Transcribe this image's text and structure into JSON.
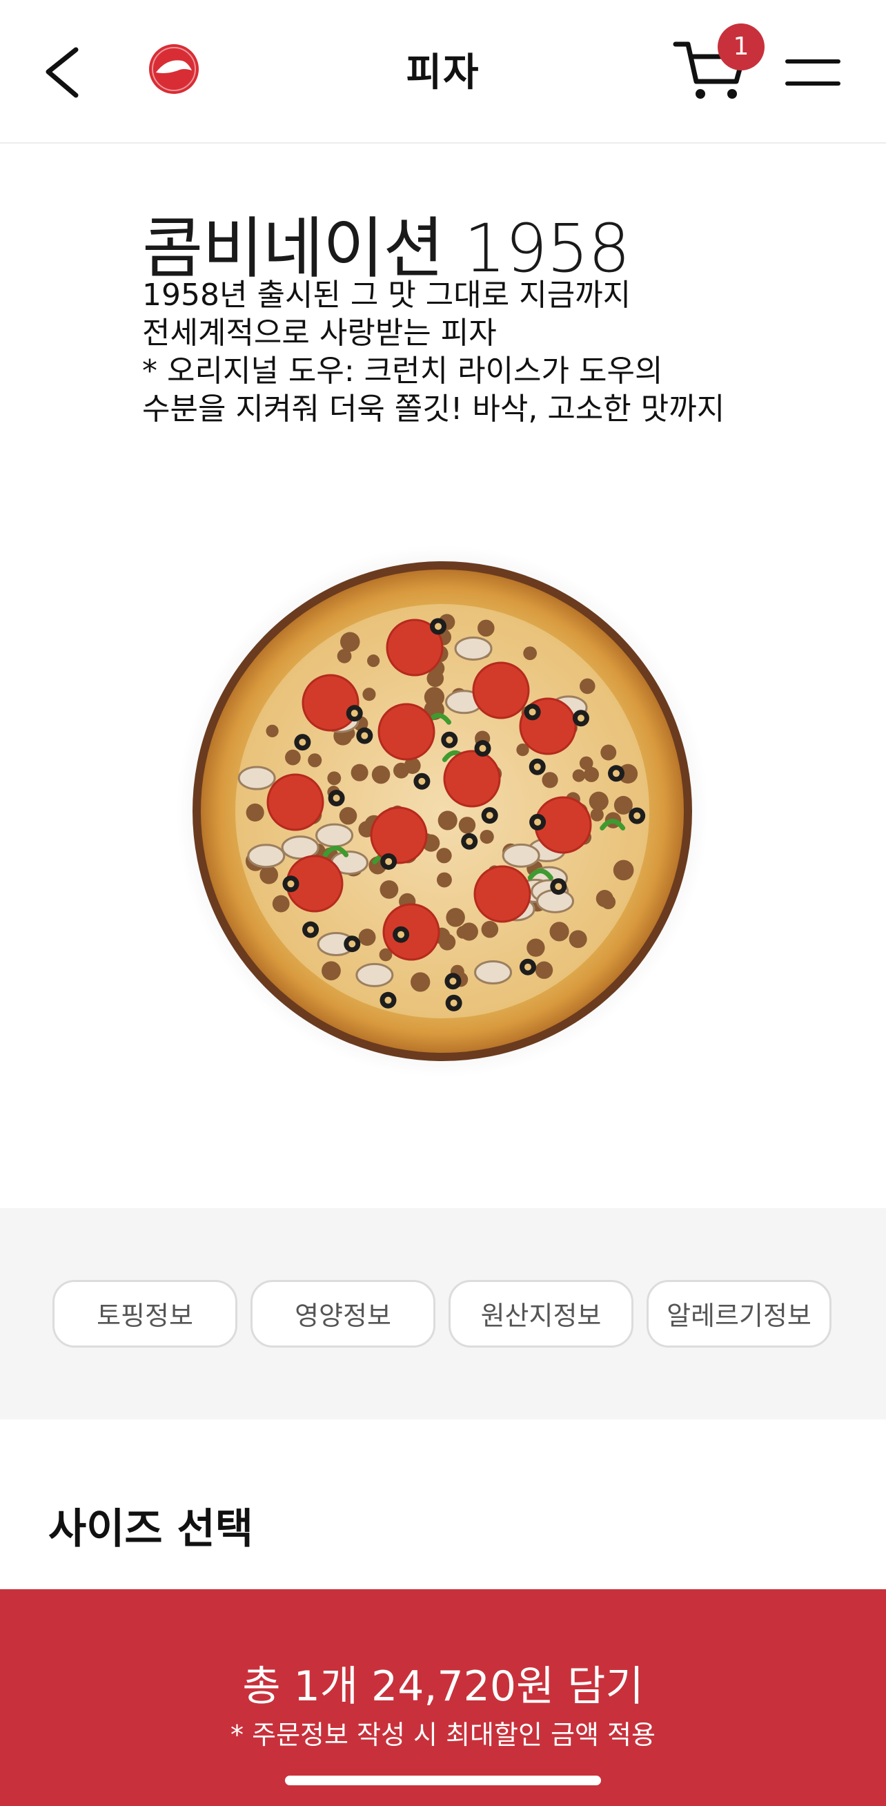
{
  "header": {
    "title": "피자",
    "cart_count": "1",
    "icons": {
      "back": "chevron-left-icon",
      "logo": "pizza-hut-logo",
      "cart": "cart-icon",
      "menu": "hamburger-menu-icon"
    }
  },
  "product": {
    "name": "콤비네이션 1958",
    "description_lines": [
      "1958년 출시된 그 맛 그대로 지금까지",
      "전세계적으로 사랑받는 피자",
      "* 오리지널 도우: 크런치 라이스가 도우의",
      "수분을 지켜줘 더욱 쫄깃! 바삭, 고소한 맛까지"
    ]
  },
  "info_buttons": [
    "토핑정보",
    "영양정보",
    "원산지정보",
    "알레르기정보"
  ],
  "size_section": {
    "heading": "사이즈 선택"
  },
  "cta": {
    "main_label": "총 1개 24,720원 담기",
    "sub_label": "* 주문정보 작성 시 최대할인 금액 적용"
  },
  "colors": {
    "accent": "#c8313b",
    "band_bg": "#f5f5f5"
  }
}
